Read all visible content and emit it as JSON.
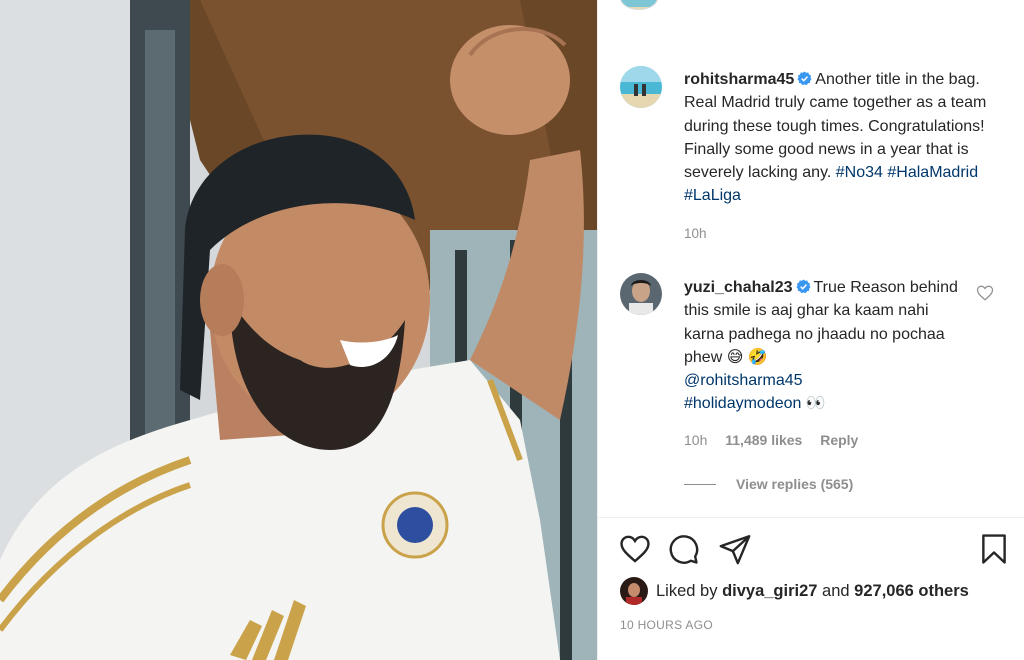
{
  "post": {
    "caption_user": "rohitsharma45",
    "caption_text": "Another title in the bag. Real Madrid truly came together as a team during these tough times. Congratulations! Finally some good news in a year that is severely lacking any.",
    "hashtags": [
      "#No34",
      "#HalaMadrid",
      "#LaLiga"
    ],
    "caption_time": "10h"
  },
  "comment": {
    "user": "yuzi_chahal23",
    "text": "True Reason behind this smile is aaj ghar ka kaam nahi karna padhega no jhaadu no pochaa phew",
    "emoji_1": "😅",
    "emoji_2": "🤣",
    "mention": "@rohitsharma45",
    "hashtag": "#holidaymodeon",
    "emoji_3": "👀",
    "time": "10h",
    "likes": "11,489 likes",
    "reply_label": "Reply",
    "view_replies": "View replies (565)"
  },
  "likes_line": {
    "prefix": "Liked by",
    "user": "divya_giri27",
    "and": "and",
    "count": "927,066 others"
  },
  "timestamp": "10 HOURS AGO",
  "icons": {
    "like": "heart-icon",
    "comment": "comment-icon",
    "share": "share-icon",
    "save": "bookmark-icon",
    "verified": "verified-badge-icon"
  },
  "colors": {
    "link": "#00376b",
    "verified": "#3897f0",
    "muted": "#8e8e8e"
  }
}
